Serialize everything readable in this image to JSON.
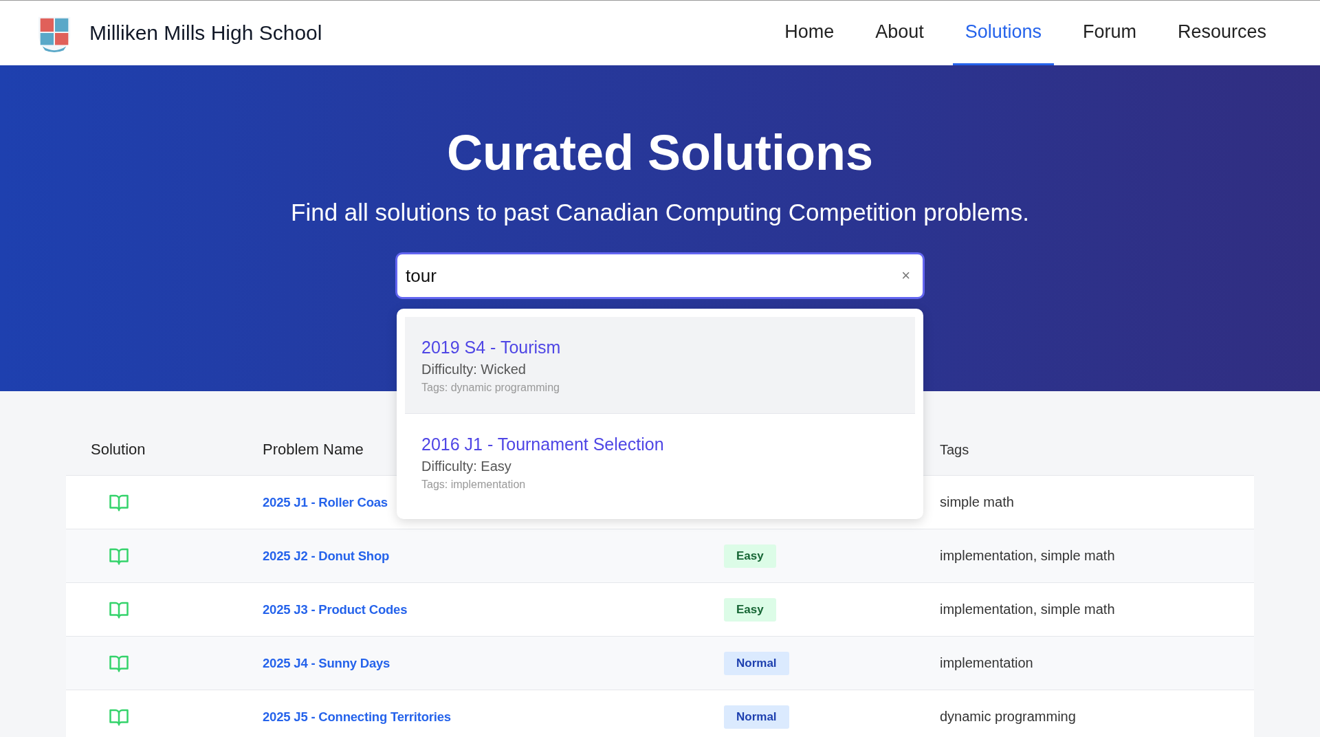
{
  "header": {
    "school_name": "Milliken Mills High School",
    "nav": [
      {
        "label": "Home",
        "selected": false
      },
      {
        "label": "About",
        "selected": false
      },
      {
        "label": "Solutions",
        "selected": true
      },
      {
        "label": "Forum",
        "selected": false
      },
      {
        "label": "Resources",
        "selected": false
      }
    ]
  },
  "hero": {
    "title": "Curated Solutions",
    "subtitle": "Find all solutions to past Canadian Computing Competition problems."
  },
  "search": {
    "value": "tour",
    "clear": "×",
    "results": [
      {
        "title": "2019 S4 - Tourism",
        "difficulty": "Difficulty: Wicked",
        "tags": "Tags: dynamic programming",
        "selected": true
      },
      {
        "title": "2016 J1 - Tournament Selection",
        "difficulty": "Difficulty: Easy",
        "tags": "Tags: implementation",
        "selected": false
      }
    ]
  },
  "table": {
    "columns": [
      "Solution",
      "Problem Name",
      "Tags"
    ],
    "rows": [
      {
        "name": "2025 J1 - Roller Coas",
        "tags": "simple math"
      },
      {
        "name": "2025 J2 - Donut Shop",
        "difficulty": "Easy",
        "kind": "easy",
        "tags": "implementation, simple math"
      },
      {
        "name": "2025 J3 - Product Codes",
        "difficulty": "Easy",
        "kind": "easy",
        "tags": "implementation, simple math"
      },
      {
        "name": "2025 J4 - Sunny Days",
        "difficulty": "Normal",
        "kind": "normal",
        "tags": "implementation"
      },
      {
        "name": "2025 J5 - Connecting Territories",
        "difficulty": "Normal",
        "kind": "normal",
        "tags": "dynamic programming"
      }
    ]
  }
}
